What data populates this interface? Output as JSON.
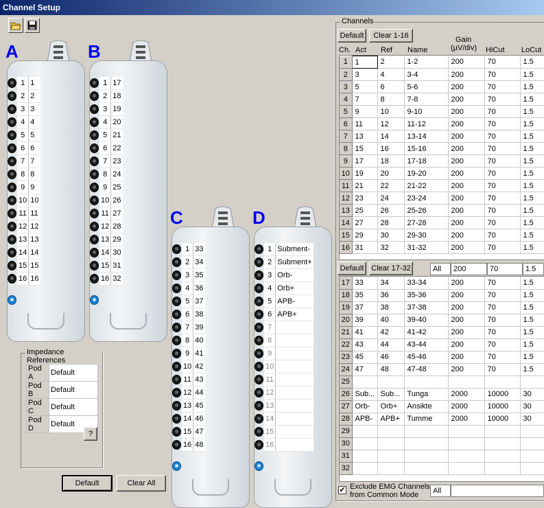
{
  "window": {
    "title": "Channel Setup"
  },
  "toolbar": {
    "open_icon": "folder-open-icon",
    "save_icon": "floppy-disk-icon"
  },
  "pods": {
    "A": {
      "letter": "A",
      "rows": [
        [
          "1",
          "1"
        ],
        [
          "2",
          "2"
        ],
        [
          "3",
          "3"
        ],
        [
          "4",
          "4"
        ],
        [
          "5",
          "5"
        ],
        [
          "6",
          "6"
        ],
        [
          "7",
          "7"
        ],
        [
          "8",
          "8"
        ],
        [
          "9",
          "9"
        ],
        [
          "10",
          "10"
        ],
        [
          "11",
          "11"
        ],
        [
          "12",
          "12"
        ],
        [
          "13",
          "13"
        ],
        [
          "14",
          "14"
        ],
        [
          "15",
          "15"
        ],
        [
          "16",
          "16"
        ]
      ]
    },
    "B": {
      "letter": "B",
      "rows": [
        [
          "1",
          "17"
        ],
        [
          "2",
          "18"
        ],
        [
          "3",
          "19"
        ],
        [
          "4",
          "20"
        ],
        [
          "5",
          "21"
        ],
        [
          "6",
          "22"
        ],
        [
          "7",
          "23"
        ],
        [
          "8",
          "24"
        ],
        [
          "9",
          "25"
        ],
        [
          "10",
          "26"
        ],
        [
          "11",
          "27"
        ],
        [
          "12",
          "28"
        ],
        [
          "13",
          "29"
        ],
        [
          "14",
          "30"
        ],
        [
          "15",
          "31"
        ],
        [
          "16",
          "32"
        ]
      ]
    },
    "C": {
      "letter": "C",
      "rows": [
        [
          "1",
          "33"
        ],
        [
          "2",
          "34"
        ],
        [
          "3",
          "35"
        ],
        [
          "4",
          "36"
        ],
        [
          "5",
          "37"
        ],
        [
          "6",
          "38"
        ],
        [
          "7",
          "39"
        ],
        [
          "8",
          "40"
        ],
        [
          "9",
          "41"
        ],
        [
          "10",
          "42"
        ],
        [
          "11",
          "43"
        ],
        [
          "12",
          "44"
        ],
        [
          "13",
          "45"
        ],
        [
          "14",
          "46"
        ],
        [
          "15",
          "47"
        ],
        [
          "16",
          "48"
        ]
      ]
    },
    "D": {
      "letter": "D",
      "rows": [
        [
          "1",
          "Subment-"
        ],
        [
          "2",
          "Subment+"
        ],
        [
          "3",
          "Orb-"
        ],
        [
          "4",
          "Orb+"
        ],
        [
          "5",
          "APB-"
        ],
        [
          "6",
          "APB+"
        ],
        [
          "7",
          ""
        ],
        [
          "8",
          ""
        ],
        [
          "9",
          ""
        ],
        [
          "10",
          ""
        ],
        [
          "11",
          ""
        ],
        [
          "12",
          ""
        ],
        [
          "13",
          ""
        ],
        [
          "14",
          ""
        ],
        [
          "15",
          ""
        ],
        [
          "16",
          ""
        ]
      ]
    }
  },
  "impedance": {
    "title": "Impedance References",
    "rows": [
      [
        "Pod A",
        "Default"
      ],
      [
        "Pod B",
        "Default"
      ],
      [
        "Pod C",
        "Default"
      ],
      [
        "Pod D",
        "Default"
      ]
    ],
    "help_label": "?"
  },
  "bottom_buttons": {
    "default_label": "Default",
    "clear_all_label": "Clear All"
  },
  "channels": {
    "title": "Channels",
    "default_label": "Default",
    "clear1_label": "Clear 1-16",
    "clear2_label": "Clear 17-32",
    "headers": {
      "ch": "Ch.",
      "act": "Act",
      "ref": "Ref",
      "name": "Name",
      "gain": "Gain",
      "gain_unit": "(µV/div)",
      "hicut": "HiCut",
      "locut": "LoCut"
    },
    "group1": [
      [
        "1",
        "1",
        "2",
        "1-2",
        "200",
        "70",
        "1.5"
      ],
      [
        "2",
        "3",
        "4",
        "3-4",
        "200",
        "70",
        "1.5"
      ],
      [
        "3",
        "5",
        "6",
        "5-6",
        "200",
        "70",
        "1.5"
      ],
      [
        "4",
        "7",
        "8",
        "7-8",
        "200",
        "70",
        "1.5"
      ],
      [
        "5",
        "9",
        "10",
        "9-10",
        "200",
        "70",
        "1.5"
      ],
      [
        "6",
        "11",
        "12",
        "11-12",
        "200",
        "70",
        "1.5"
      ],
      [
        "7",
        "13",
        "14",
        "13-14",
        "200",
        "70",
        "1.5"
      ],
      [
        "8",
        "15",
        "16",
        "15-16",
        "200",
        "70",
        "1.5"
      ],
      [
        "9",
        "17",
        "18",
        "17-18",
        "200",
        "70",
        "1.5"
      ],
      [
        "10",
        "19",
        "20",
        "19-20",
        "200",
        "70",
        "1.5"
      ],
      [
        "11",
        "21",
        "22",
        "21-22",
        "200",
        "70",
        "1.5"
      ],
      [
        "12",
        "23",
        "24",
        "23-24",
        "200",
        "70",
        "1.5"
      ],
      [
        "13",
        "25",
        "26",
        "25-26",
        "200",
        "70",
        "1.5"
      ],
      [
        "14",
        "27",
        "28",
        "27-28",
        "200",
        "70",
        "1.5"
      ],
      [
        "15",
        "29",
        "30",
        "29-30",
        "200",
        "70",
        "1.5"
      ],
      [
        "16",
        "31",
        "32",
        "31-32",
        "200",
        "70",
        "1.5"
      ]
    ],
    "group2_defaults": {
      "all_label": "All",
      "gain": "200",
      "hicut": "70",
      "locut": "1.5"
    },
    "group2": [
      [
        "17",
        "33",
        "34",
        "33-34",
        "200",
        "70",
        "1.5"
      ],
      [
        "18",
        "35",
        "36",
        "35-36",
        "200",
        "70",
        "1.5"
      ],
      [
        "19",
        "37",
        "38",
        "37-38",
        "200",
        "70",
        "1.5"
      ],
      [
        "20",
        "39",
        "40",
        "39-40",
        "200",
        "70",
        "1.5"
      ],
      [
        "21",
        "41",
        "42",
        "41-42",
        "200",
        "70",
        "1.5"
      ],
      [
        "22",
        "43",
        "44",
        "43-44",
        "200",
        "70",
        "1.5"
      ],
      [
        "23",
        "45",
        "46",
        "45-46",
        "200",
        "70",
        "1.5"
      ],
      [
        "24",
        "47",
        "48",
        "47-48",
        "200",
        "70",
        "1.5"
      ],
      [
        "25",
        "",
        "",
        "",
        "",
        "",
        ""
      ],
      [
        "26",
        "Sub...",
        "Sub...",
        "Tunga",
        "2000",
        "10000",
        "30"
      ],
      [
        "27",
        "Orb-",
        "Orb+",
        "Ansikte",
        "2000",
        "10000",
        "30"
      ],
      [
        "28",
        "APB-",
        "APB+",
        "Tumme",
        "2000",
        "10000",
        "30"
      ],
      [
        "29",
        "",
        "",
        "",
        "",
        "",
        ""
      ],
      [
        "30",
        "",
        "",
        "",
        "",
        "",
        ""
      ],
      [
        "31",
        "",
        "",
        "",
        "",
        "",
        ""
      ],
      [
        "32",
        "",
        "",
        "",
        "",
        "",
        ""
      ]
    ],
    "exclude_label_1": "Exclude EMG Channels",
    "exclude_label_2": "from Common Mode",
    "exclude_checked": "✔",
    "exclude_all": "All"
  }
}
